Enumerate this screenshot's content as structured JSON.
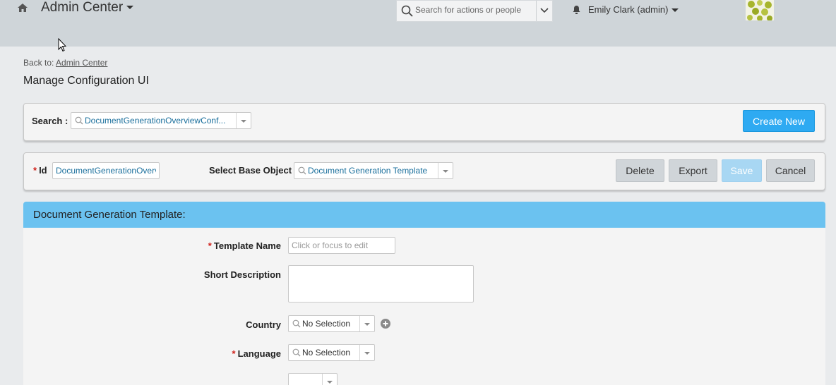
{
  "header": {
    "app_title": "Admin Center",
    "search_placeholder": "Search for actions or people",
    "user_name": "Emily Clark (admin)"
  },
  "breadcrumb": {
    "back_prefix": "Back to:",
    "back_link": "Admin Center"
  },
  "page_title": "Manage Configuration UI",
  "search_panel": {
    "label": "Search :",
    "value": "DocumentGenerationOverviewConf...",
    "create_label": "Create New"
  },
  "id_panel": {
    "id_label": "Id",
    "id_value": "DocumentGenerationOverv",
    "base_object_label": "Select Base Object",
    "base_object_value": "Document Generation Template",
    "delete_label": "Delete",
    "export_label": "Export",
    "save_label": "Save",
    "cancel_label": "Cancel"
  },
  "form": {
    "header": "Document Generation Template:",
    "template_name_label": "Template Name",
    "template_name_placeholder": "Click or focus to edit",
    "short_description_label": "Short Description",
    "country_label": "Country",
    "country_value": "No Selection",
    "language_label": "Language",
    "language_value": "No Selection"
  },
  "colors": {
    "accent": "#2eaaf2",
    "section_header": "#6bc2f0",
    "required": "#d0211b",
    "topbar": "#cfd5d9"
  },
  "icons": [
    "home-icon",
    "search-icon",
    "chevron-down-icon",
    "bell-icon",
    "avatar",
    "plus-circle-icon",
    "cursor-icon"
  ]
}
